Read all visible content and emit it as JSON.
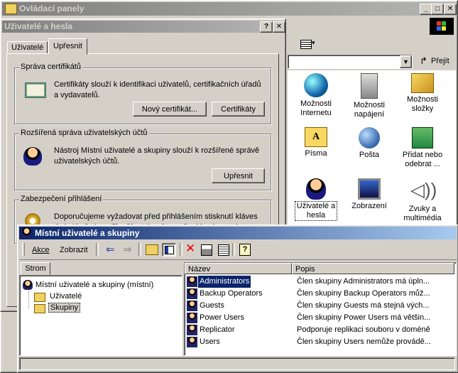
{
  "control_panel": {
    "title": "Ovládací panely",
    "go_label": "Přejít",
    "items": [
      {
        "label1": "Možnosti",
        "label2": "Internetu"
      },
      {
        "label1": "Možnosti",
        "label2": "napájení"
      },
      {
        "label1": "Možnosti",
        "label2": "složky"
      },
      {
        "label1": "Písma",
        "label2": ""
      },
      {
        "label1": "Pošta",
        "label2": ""
      },
      {
        "label1": "Přidat nebo",
        "label2": "odebrat ..."
      },
      {
        "label1": "Uživatelé a",
        "label2": "hesla"
      },
      {
        "label1": "Zobrazení",
        "label2": ""
      },
      {
        "label1": "Zvuky a",
        "label2": "multimédia"
      }
    ]
  },
  "users_dialog": {
    "title": "Uživatelé a hesla",
    "help_label": "?",
    "close_label": "✕",
    "tabs": [
      "Uživatelé",
      "Upřesnit"
    ],
    "certs": {
      "title": "Správa certifikátů",
      "text": "Certifikáty slouží k identifikaci uživatelů, certifikačních úřadů a vydavatelů.",
      "btn_new": "Nový certifikát...",
      "btn_certs": "Certifikáty"
    },
    "advanced": {
      "title": "Rozšířená správa uživatelských účtů",
      "text": "Nástroj Místní uživatelé a skupiny slouží k rozšířené správě uživatelských účtů.",
      "btn": "Upřesnit"
    },
    "security": {
      "title": "Zabezpečení přihlášení",
      "text": "Doporučujeme vyžadovat před přihlášením stisknutí kláves Ctrl+Alt+Delete. Zlepšíte tak zabezpečení hesla a ochranu"
    }
  },
  "mmc": {
    "title": "Místní uživatelé a skupiny",
    "menu_action": "Akce",
    "menu_view": "Zobrazit",
    "tree_tab": "Strom",
    "tree": {
      "root": "Místní uživatelé a skupiny (místní)",
      "users": "Uživatelé",
      "groups": "Skupiny"
    },
    "columns": {
      "name": "Název",
      "desc": "Popis"
    },
    "rows": [
      {
        "name": "Administrators",
        "desc": "Člen skupiny Administrators má úpln..."
      },
      {
        "name": "Backup Operators",
        "desc": "Člen skupiny Backup Operators můž..."
      },
      {
        "name": "Guests",
        "desc": "Člen skupiny Guests má stejná vých..."
      },
      {
        "name": "Power Users",
        "desc": "Člen skupiny Power Users má většin..."
      },
      {
        "name": "Replicator",
        "desc": "Podporuje replikaci souboru v doméně"
      },
      {
        "name": "Users",
        "desc": "Člen skupiny Users nemůže provádě..."
      }
    ]
  },
  "colors": {
    "active_title": "#0a246a",
    "inactive_title": "#808080",
    "selection": "#0a246a",
    "face": "#d4d0c8"
  }
}
